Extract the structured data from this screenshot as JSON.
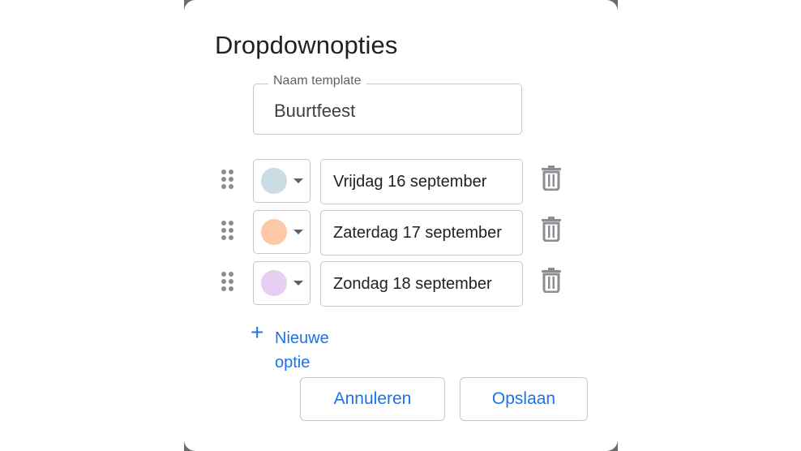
{
  "dialog": {
    "title": "Dropdownopties",
    "template_name": {
      "label": "Naam template",
      "value": "Buurtfeest"
    },
    "options": [
      {
        "label": "Vrijdag 16 september",
        "color": "#c9dce3",
        "color_icon": "color-swatch",
        "delete_icon": "trash-icon",
        "drag_icon": "drag-handle-icon"
      },
      {
        "label": "Zaterdag 17 september",
        "color": "#fdc8a6",
        "color_icon": "color-swatch",
        "delete_icon": "trash-icon",
        "drag_icon": "drag-handle-icon"
      },
      {
        "label": "Zondag 18 september",
        "color": "#e6cff2",
        "color_icon": "color-swatch",
        "delete_icon": "trash-icon",
        "drag_icon": "drag-handle-icon"
      }
    ],
    "new_option": {
      "icon": "plus-icon",
      "label": "Nieuwe optie"
    },
    "buttons": {
      "cancel": "Annuleren",
      "save": "Opslaan"
    }
  },
  "colors": {
    "accent": "#1a73e8",
    "border": "#c4c7c5",
    "icon_gray": "#8a8d91",
    "text": "#202124"
  }
}
